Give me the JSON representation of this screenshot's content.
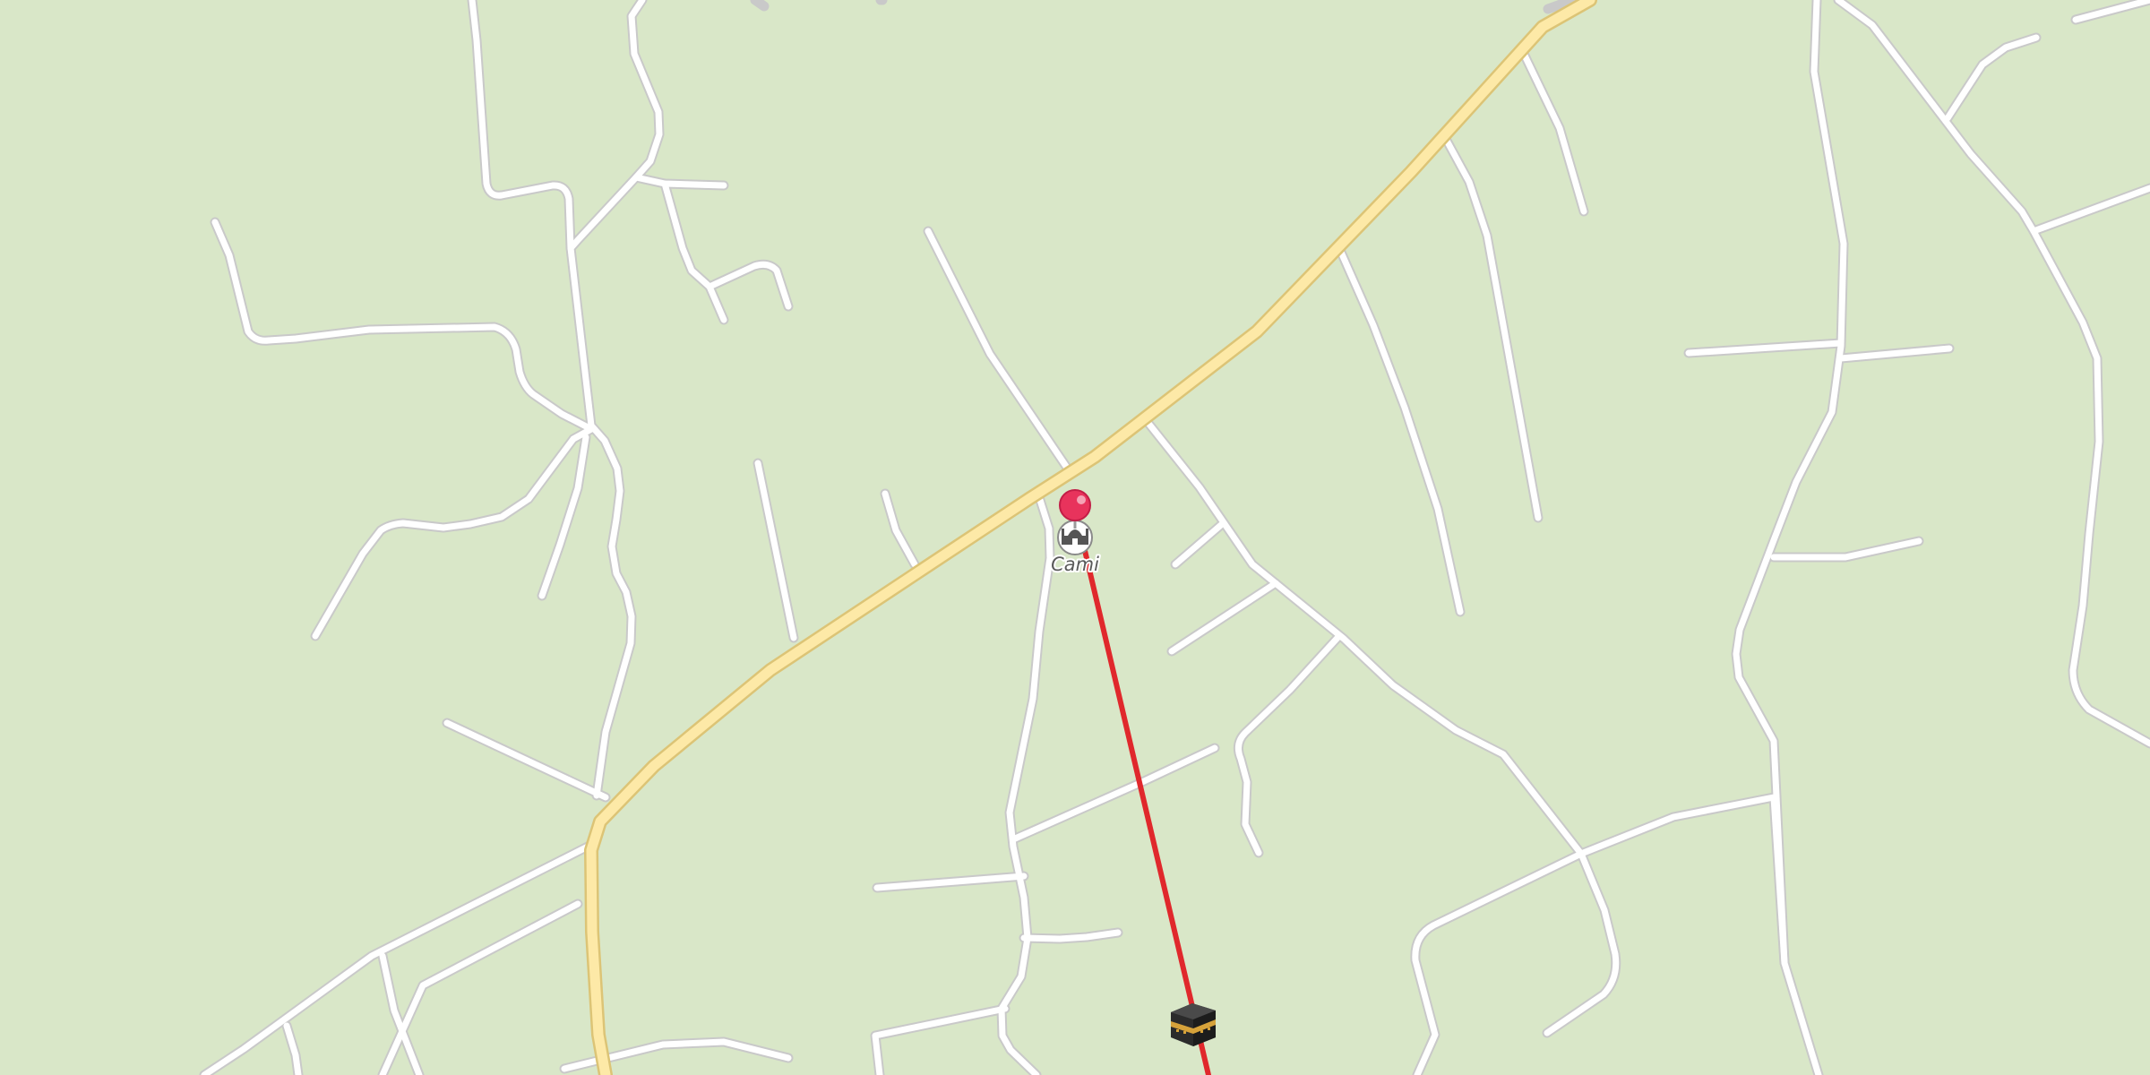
{
  "map": {
    "background_color": "#d9e7c8",
    "minor_road_color": "#ffffff",
    "minor_road_casing_color": "#c9c9c9",
    "main_road_color": "#fde9a7",
    "main_road_casing_color": "#dcc476",
    "qibla_line_color": "#e0282c"
  },
  "poi": {
    "name": "Cami",
    "icon": "mosque-icon"
  },
  "location_pin": {
    "icon": "location-pin-icon",
    "color": "#e8335c"
  },
  "qibla": {
    "icon": "kaaba-icon",
    "description_icon": "kaaba"
  }
}
